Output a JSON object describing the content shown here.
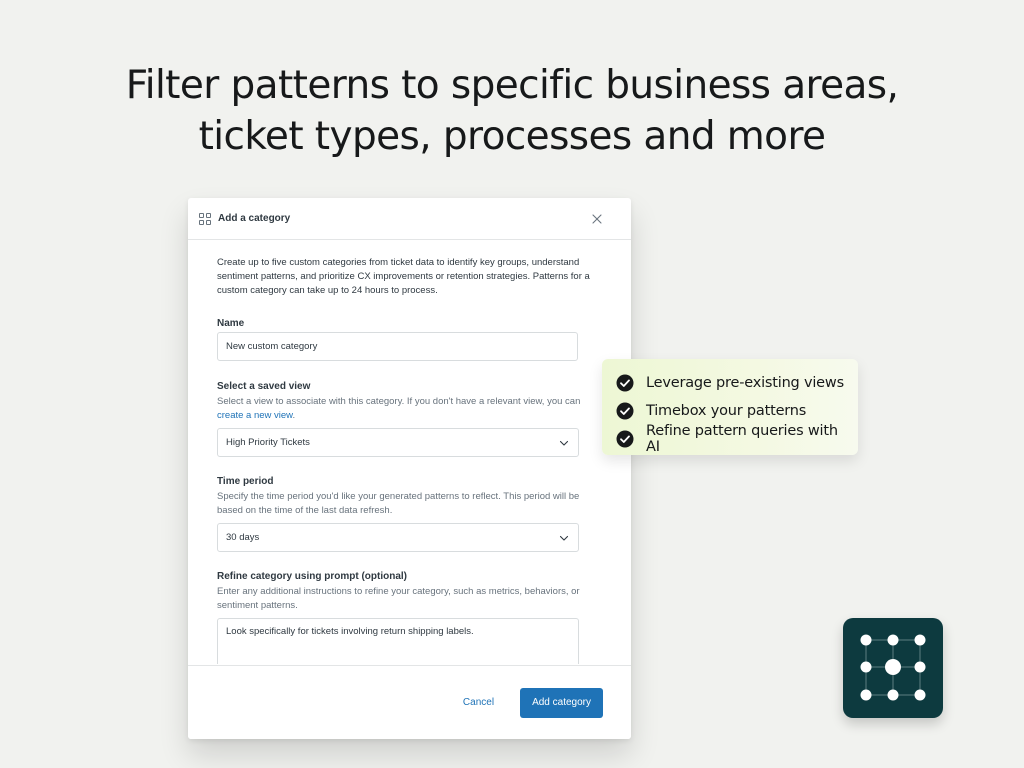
{
  "headline": {
    "line1": "Filter patterns to specific business areas,",
    "line2": "ticket types, processes and more"
  },
  "modal": {
    "title": "Add a category",
    "title_icon": "grid-icon",
    "close_icon": "close-icon",
    "description": "Create up to five custom categories from ticket data to identify key groups, understand sentiment patterns, and prioritize CX improvements or retention strategies. Patterns for a custom category can take up to 24 hours to process.",
    "fields": {
      "name": {
        "label": "Name",
        "value": "New custom category"
      },
      "saved_view": {
        "label": "Select a saved view",
        "help_prefix": "Select a view to associate with this category. If you don't have a relevant view, you can ",
        "help_link": "create a new view",
        "help_suffix": ".",
        "value": "High Priority Tickets"
      },
      "time_period": {
        "label": "Time period",
        "help": "Specify the time period you'd like your generated patterns to reflect. This period will be based on the time of the last data refresh.",
        "value": "30 days"
      },
      "prompt": {
        "label": "Refine category using prompt (optional)",
        "help": "Enter any additional instructions to refine your category, such as metrics, behaviors, or sentiment patterns.",
        "value": "Look specifically for tickets involving return shipping labels."
      }
    },
    "footer": {
      "cancel_label": "Cancel",
      "submit_label": "Add category"
    }
  },
  "features": {
    "items": [
      {
        "label": "Leverage pre-existing views",
        "icon": "check-circle-icon"
      },
      {
        "label": "Timebox your patterns",
        "icon": "check-circle-icon"
      },
      {
        "label": "Refine pattern queries with AI",
        "icon": "check-circle-icon"
      }
    ]
  },
  "app_tile": {
    "icon": "dot-grid-logo-icon"
  },
  "colors": {
    "background": "#f1f2ef",
    "accent": "#1f73b7",
    "feature_card": "#edf7d4",
    "app_tile": "#0d3a3f"
  }
}
